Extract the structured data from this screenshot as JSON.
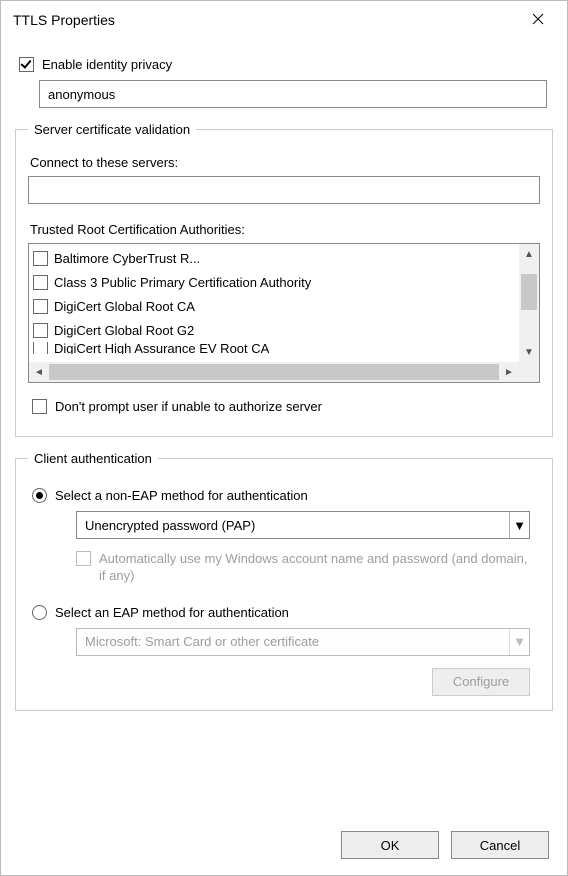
{
  "titlebar": {
    "title": "TTLS Properties"
  },
  "privacy": {
    "checkbox_label": "Enable identity privacy",
    "checked": true,
    "identity_value": "anonymous"
  },
  "server_validation": {
    "legend": "Server certificate validation",
    "connect_label": "Connect to these servers:",
    "connect_value": "",
    "ca_list_label": "Trusted Root Certification Authorities:",
    "ca_items": [
      {
        "label": "Baltimore CyberTrust R...",
        "checked": false
      },
      {
        "label": "Class 3 Public Primary Certification Authority",
        "checked": false
      },
      {
        "label": "DigiCert Global Root CA",
        "checked": false
      },
      {
        "label": "DigiCert Global Root G2",
        "checked": false
      }
    ],
    "ca_partial_item": {
      "label": "DigiCert High Assurance EV Root CA",
      "checked": false
    },
    "dont_prompt_label": "Don't prompt user if unable to authorize server",
    "dont_prompt_checked": false
  },
  "client_auth": {
    "legend": "Client authentication",
    "non_eap": {
      "radio_label": "Select a non-EAP method for authentication",
      "selected": true,
      "dropdown_value": "Unencrypted password (PAP)",
      "auto_creds_label": "Automatically use my Windows account name and password (and domain, if any)",
      "auto_creds_checked": false,
      "auto_creds_enabled": false
    },
    "eap": {
      "radio_label": "Select an EAP method for authentication",
      "selected": false,
      "dropdown_value": "Microsoft: Smart Card or other certificate",
      "dropdown_enabled": false,
      "configure_label": "Configure",
      "configure_enabled": false
    }
  },
  "buttons": {
    "ok": "OK",
    "cancel": "Cancel"
  }
}
